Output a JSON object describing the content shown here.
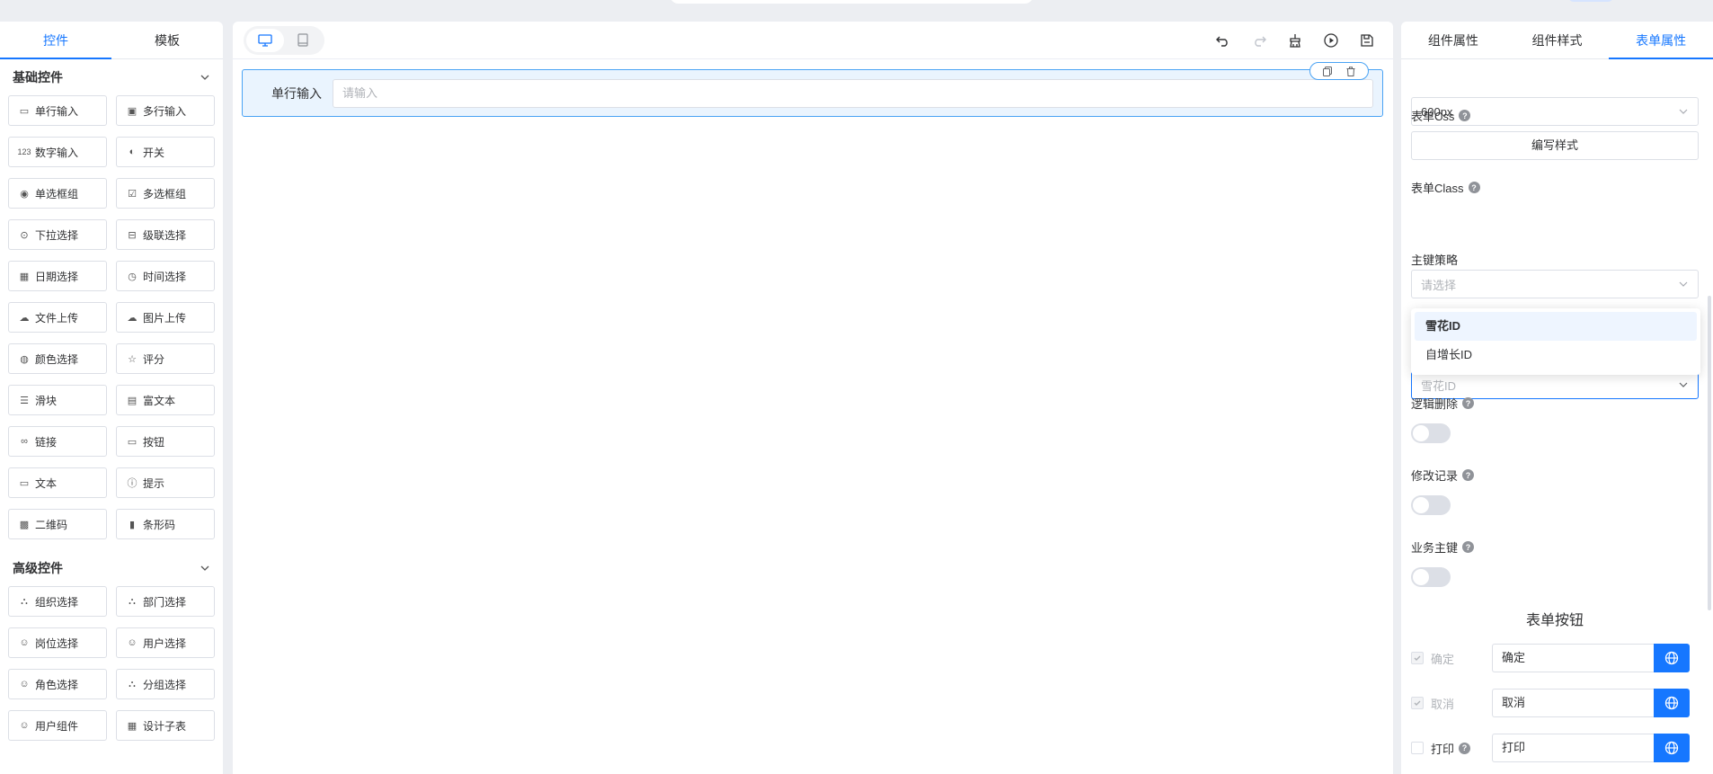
{
  "left_panel": {
    "tabs": [
      {
        "label": "控件",
        "active": true
      },
      {
        "label": "模板",
        "active": false
      }
    ],
    "basic_group": {
      "title": "基础控件",
      "items": [
        {
          "label": "单行输入",
          "icon": "single-line-input-icon"
        },
        {
          "label": "多行输入",
          "icon": "multi-line-input-icon"
        },
        {
          "label": "数字输入",
          "icon": "number-input-icon"
        },
        {
          "label": "开关",
          "icon": "switch-icon"
        },
        {
          "label": "单选框组",
          "icon": "radio-icon"
        },
        {
          "label": "多选框组",
          "icon": "checkbox-icon"
        },
        {
          "label": "下拉选择",
          "icon": "select-icon"
        },
        {
          "label": "级联选择",
          "icon": "cascader-icon"
        },
        {
          "label": "日期选择",
          "icon": "date-icon"
        },
        {
          "label": "时间选择",
          "icon": "clock-icon"
        },
        {
          "label": "文件上传",
          "icon": "upload-file-icon"
        },
        {
          "label": "图片上传",
          "icon": "upload-image-icon"
        },
        {
          "label": "颜色选择",
          "icon": "palette-icon"
        },
        {
          "label": "评分",
          "icon": "star-icon"
        },
        {
          "label": "滑块",
          "icon": "slider-icon"
        },
        {
          "label": "富文本",
          "icon": "rich-text-icon"
        },
        {
          "label": "链接",
          "icon": "link-icon"
        },
        {
          "label": "按钮",
          "icon": "button-icon"
        },
        {
          "label": "文本",
          "icon": "text-icon"
        },
        {
          "label": "提示",
          "icon": "alert-icon"
        },
        {
          "label": "二维码",
          "icon": "qrcode-icon"
        },
        {
          "label": "条形码",
          "icon": "barcode-icon"
        }
      ]
    },
    "advanced_group": {
      "title": "高级控件",
      "items": [
        {
          "label": "组织选择",
          "icon": "org-icon"
        },
        {
          "label": "部门选择",
          "icon": "dept-icon"
        },
        {
          "label": "岗位选择",
          "icon": "post-icon"
        },
        {
          "label": "用户选择",
          "icon": "user-icon"
        },
        {
          "label": "角色选择",
          "icon": "role-icon"
        },
        {
          "label": "分组选择",
          "icon": "group-icon"
        },
        {
          "label": "用户组件",
          "icon": "user-component-icon"
        },
        {
          "label": "设计子表",
          "icon": "table-icon"
        }
      ]
    }
  },
  "canvas": {
    "form_row": {
      "label": "单行输入",
      "placeholder": "请输入"
    }
  },
  "right_panel": {
    "tabs": [
      {
        "label": "组件属性",
        "active": false
      },
      {
        "label": "组件样式",
        "active": false
      },
      {
        "label": "表单属性",
        "active": true
      }
    ],
    "width_select": "600px",
    "form_css_label": "表单Css",
    "edit_style_button": "编写样式",
    "form_class_label": "表单Class",
    "form_class_placeholder": "请选择",
    "pk_strategy_label": "主键策略",
    "pk_strategy_placeholder": "雪花ID",
    "pk_options": [
      "雪花ID",
      "自增长ID"
    ],
    "logic_delete_label": "逻辑删除",
    "modify_record_label": "修改记录",
    "business_key_label": "业务主键",
    "form_buttons_title": "表单按钮",
    "buttons": [
      {
        "label": "确定",
        "value": "确定",
        "checked": true,
        "disabled": true
      },
      {
        "label": "取消",
        "value": "取消",
        "checked": true,
        "disabled": true
      },
      {
        "label": "打印",
        "value": "打印",
        "checked": false,
        "disabled": false
      }
    ]
  },
  "colors": {
    "accent": "#1677ff",
    "selected_row_bg": "#eaf4fe",
    "selected_row_border": "#4aa3f4"
  }
}
